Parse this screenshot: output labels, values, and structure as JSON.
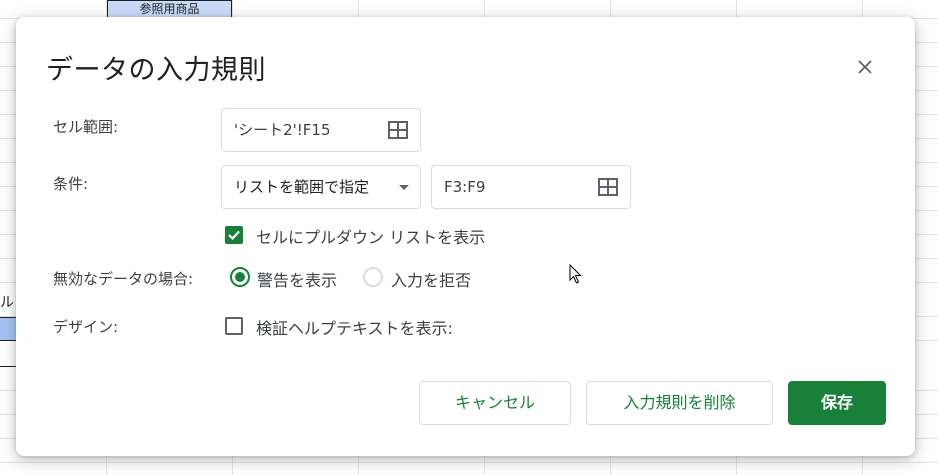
{
  "background_sheet": {
    "top_cell_text": "参照用商品",
    "left_cell_text": "ル"
  },
  "dialog": {
    "title": "データの入力規則",
    "close_icon": "close-icon",
    "cell_range": {
      "label": "セル範囲:",
      "value": "'シート2'!F15",
      "icon": "grid-select-icon"
    },
    "criteria": {
      "label": "条件:",
      "type_selected": "リストを範囲で指定",
      "range_value": "F3:F9",
      "range_icon": "grid-select-icon"
    },
    "dropdown_option": {
      "label": "セルにプルダウン リストを表示",
      "checked": true
    },
    "invalid_data": {
      "label": "無効なデータの場合:",
      "options": [
        {
          "label": "警告を表示",
          "selected": true
        },
        {
          "label": "入力を拒否",
          "selected": false
        }
      ]
    },
    "appearance": {
      "label": "デザイン:",
      "help_text_option": "検証ヘルプテキストを表示:",
      "checked": false
    },
    "buttons": {
      "cancel": "キャンセル",
      "remove": "入力規則を削除",
      "save": "保存"
    }
  },
  "colors": {
    "accent": "#188038",
    "border": "#dadce0",
    "text": "#3c4043"
  }
}
